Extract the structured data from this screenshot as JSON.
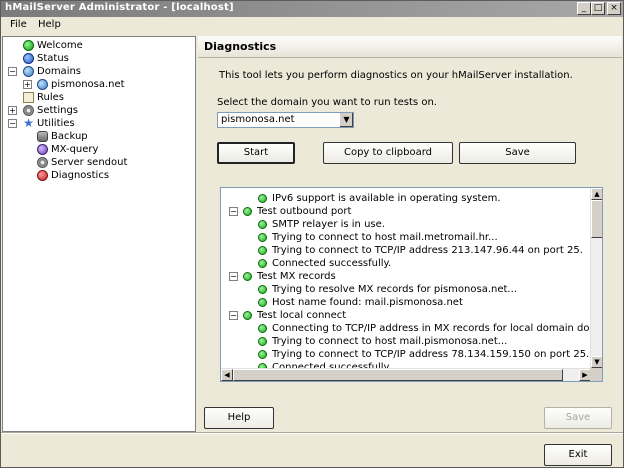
{
  "window": {
    "title": "hMailServer Administrator - [localhost]",
    "min_glyph": "_",
    "max_glyph": "□",
    "close_glyph": "×"
  },
  "menu": {
    "file": "File",
    "help": "Help"
  },
  "tree": {
    "welcome": "Welcome",
    "status": "Status",
    "domains": "Domains",
    "domain_item": "pismonosa.net",
    "rules": "Rules",
    "settings": "Settings",
    "utilities": "Utilities",
    "backup": "Backup",
    "mx_query": "MX-query",
    "server_sendout": "Server sendout",
    "diagnostics": "Diagnostics",
    "expand_glyph": "+",
    "collapse_glyph": "−"
  },
  "panel": {
    "title": "Diagnostics",
    "intro": "This tool lets you perform diagnostics on your hMailServer installation.",
    "select_label": "Select the domain you want to run tests on.",
    "selected_domain": "pismonosa.net",
    "arrow_glyph": "▼",
    "start": "Start",
    "copy": "Copy to clipboard",
    "save": "Save",
    "help": "Help",
    "save_bottom": "Save"
  },
  "log": [
    {
      "text": "IPv6 support is available in operating system.",
      "level": 1
    },
    {
      "text": "Test outbound port",
      "level": 0
    },
    {
      "text": "SMTP relayer is in use.",
      "level": 1
    },
    {
      "text": "Trying to connect to host mail.metromail.hr...",
      "level": 1
    },
    {
      "text": "Trying to connect to TCP/IP address 213.147.96.44 on port 25.",
      "level": 1
    },
    {
      "text": "Connected successfully.",
      "level": 1
    },
    {
      "text": "Test MX records",
      "level": 0
    },
    {
      "text": "Trying to resolve MX records for pismonosa.net...",
      "level": 1
    },
    {
      "text": "Host name found: mail.pismonosa.net",
      "level": 1
    },
    {
      "text": "Test local connect",
      "level": 0
    },
    {
      "text": "Connecting to TCP/IP address in MX records for local domain domain pismonosa.net...",
      "level": 1
    },
    {
      "text": "Trying to connect to host mail.pismonosa.net...",
      "level": 1
    },
    {
      "text": "Trying to connect to TCP/IP address 78.134.159.150 on port 25.",
      "level": 1
    },
    {
      "text": "Connected successfully.",
      "level": 1
    }
  ],
  "scroll": {
    "up": "▲",
    "down": "▼",
    "left": "◀",
    "right": "▶"
  },
  "footer": {
    "exit": "Exit"
  }
}
